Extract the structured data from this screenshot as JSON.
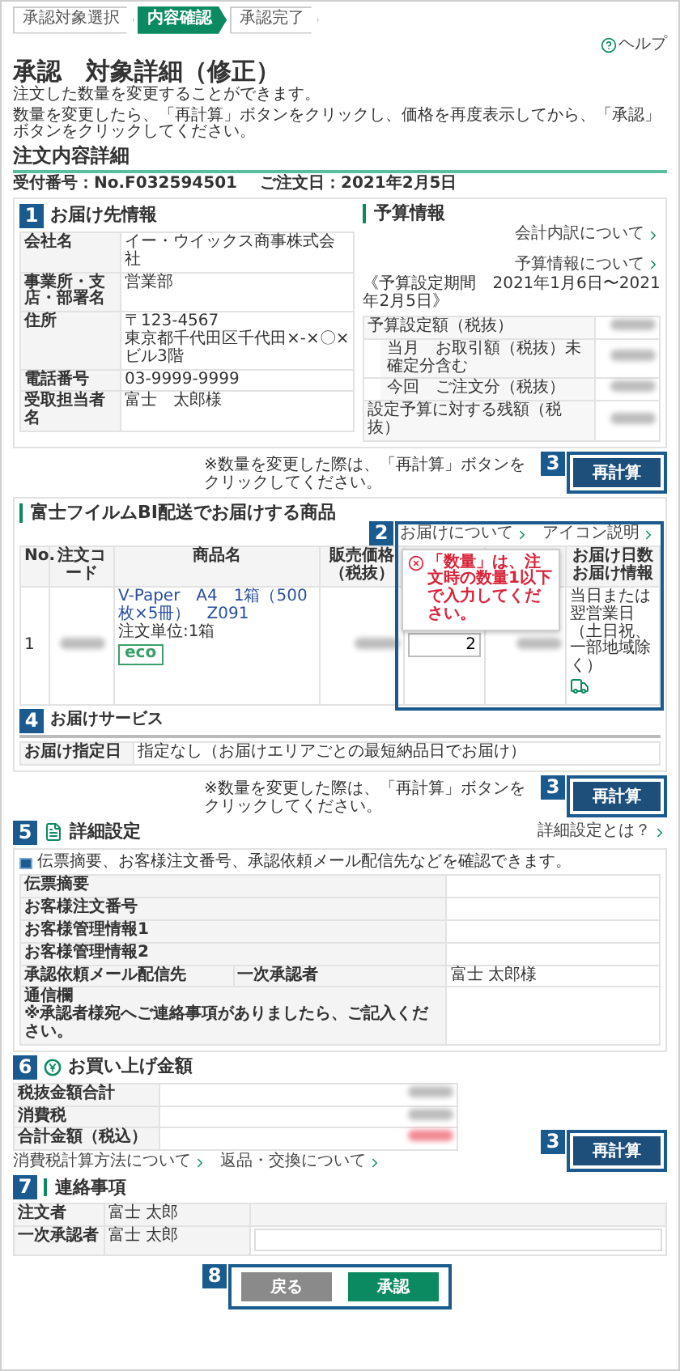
{
  "steps": [
    {
      "label": "承認対象選択",
      "selected": false
    },
    {
      "label": "内容確認",
      "selected": true
    },
    {
      "label": "承認完了",
      "selected": false
    }
  ],
  "help": "ヘルプ",
  "title": "承認　対象詳細（修正）",
  "description": [
    "注文した数量を変更することができます。",
    "数量を変更したら、「再計算」ボタンをクリックし、価格を再度表示してから、「承認」ボタンをクリックしてください。"
  ],
  "section_title": "注文内容詳細",
  "order_info": {
    "receipt": "受付番号：No.F032594501",
    "date": "ご注文日：2021年2月5日"
  },
  "delivery": {
    "marker": "1",
    "title": "お届け先情報",
    "rows": [
      {
        "label": "会社名",
        "value": [
          "イー・ウイックス商事株式会社"
        ]
      },
      {
        "label": "事業所・支店・部署名",
        "value": [
          "営業部"
        ]
      },
      {
        "label": "住所",
        "value": [
          "〒123-4567",
          "東京都千代田区千代田×-×〇×ビル3階"
        ]
      },
      {
        "label": "電話番号",
        "value": [
          "03-9999-9999"
        ]
      },
      {
        "label": "受取担当者名",
        "value": [
          "富士　太郎様"
        ]
      }
    ]
  },
  "budget": {
    "title": "予算情報",
    "links": [
      "会計内訳について",
      "予算情報について"
    ],
    "period": "《予算設定期間　2021年1月6日〜2021年2月5日》",
    "rows": [
      {
        "label": "予算設定額（税抜）",
        "sub": false
      },
      {
        "label": "当月　お取引額（税抜）未確定分含む",
        "sub": true
      },
      {
        "label": "今回　ご注文分（税抜）",
        "sub": true
      },
      {
        "label": "設定予算に対する残額（税抜）",
        "sub": false
      }
    ]
  },
  "recalc": [
    {
      "marker": "3",
      "note": "※数量を変更した際は、「再計算」ボタンをクリックしてください。",
      "button": "再計算"
    },
    {
      "marker": "3",
      "note": "※数量を変更した際は、「再計算」ボタンをクリックしてください。",
      "button": "再計算"
    },
    {
      "marker": "3",
      "button": "再計算"
    }
  ],
  "products": {
    "marker": "2",
    "title": "富士フイルムBI配送でお届けする商品",
    "links": [
      "お届けについて",
      "アイコン説明"
    ],
    "columns": [
      {
        "kind": "text",
        "label": "No."
      },
      {
        "kind": "text",
        "label": "注文コード"
      },
      {
        "kind": "text",
        "label": "商品名"
      },
      {
        "kind": "text",
        "label": "販売価格（税抜）"
      },
      {
        "kind": "covered"
      },
      {
        "kind": "covered"
      },
      {
        "kind": "text",
        "label": "お届け日数お届け情報"
      }
    ],
    "rows": [
      {
        "no": "1",
        "name": "V-Paper　A4　1箱（500枚×5冊）　Z091",
        "unit": "注文単位:1箱",
        "badge": "eco",
        "quantity": "2",
        "delivery": "当日または翌営業日（土日祝、一部地域除く）"
      }
    ],
    "tooltip": "「数量」は、注文時の数量1以下で入力してください。"
  },
  "delivery_service": {
    "marker": "4",
    "title": "お届けサービス",
    "rows": [
      {
        "label": "お届け指定日",
        "value": "指定なし（お届けエリアごとの最短納品日でお届け）"
      }
    ]
  },
  "details": {
    "marker": "5",
    "title": "詳細設定",
    "link": "詳細設定とは？",
    "info": "伝票摘要、お客様注文番号、承認依頼メール配信先などを確認できます。",
    "rows": [
      {
        "kind": "plain",
        "label": "伝票摘要"
      },
      {
        "kind": "plain",
        "label": "お客様注文番号"
      },
      {
        "kind": "plain",
        "label": "お客様管理情報1"
      },
      {
        "kind": "plain",
        "label": "お客様管理情報2"
      },
      {
        "kind": "split",
        "label": "承認依頼メール配信先",
        "sublabel": "一次承認者",
        "value": "富士 太郎様"
      },
      {
        "kind": "note",
        "label": "通信欄",
        "note": "※承認者様宛へご連絡事項がありましたら、ご記入ください。"
      }
    ]
  },
  "purchase": {
    "marker": "6",
    "title": "お買い上げ金額",
    "rows": [
      {
        "label": "税抜金額合計",
        "emphasis": false
      },
      {
        "label": "消費税",
        "emphasis": false
      },
      {
        "label": "合計金額（税込）",
        "emphasis": true
      }
    ],
    "links": [
      "消費税計算方法について",
      "返品・交換について"
    ]
  },
  "contact": {
    "marker": "7",
    "title": "連絡事項",
    "rows": [
      {
        "kind": "text",
        "label": "注文者",
        "value": "富士 太郎"
      },
      {
        "kind": "input",
        "label": "一次承認者",
        "value": "富士 太郎"
      }
    ]
  },
  "actions": {
    "marker": "8",
    "buttons": [
      {
        "label": "戻る",
        "kind": "secondary"
      },
      {
        "label": "承認",
        "kind": "primary"
      }
    ]
  }
}
